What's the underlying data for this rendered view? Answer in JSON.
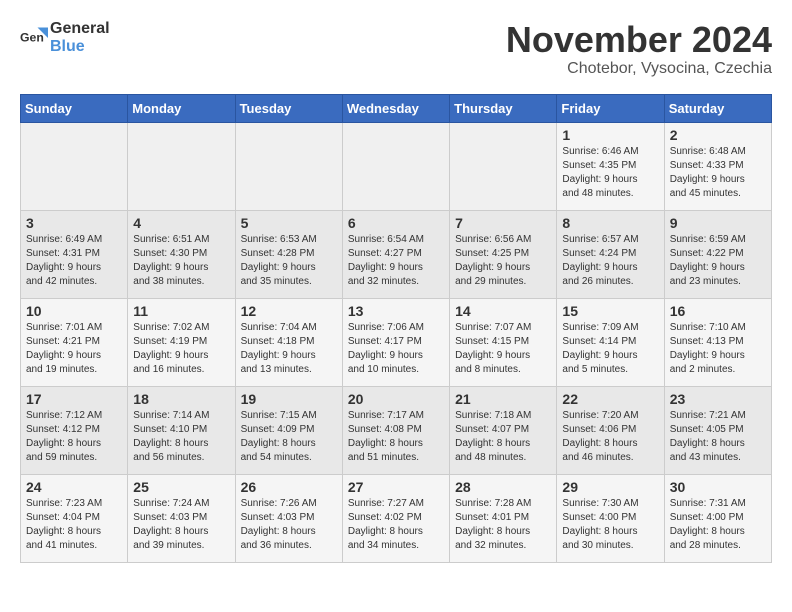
{
  "header": {
    "logo_general": "General",
    "logo_blue": "Blue",
    "month_title": "November 2024",
    "subtitle": "Chotebor, Vysocina, Czechia"
  },
  "calendar": {
    "weekdays": [
      "Sunday",
      "Monday",
      "Tuesday",
      "Wednesday",
      "Thursday",
      "Friday",
      "Saturday"
    ],
    "weeks": [
      [
        {
          "day": "",
          "info": ""
        },
        {
          "day": "",
          "info": ""
        },
        {
          "day": "",
          "info": ""
        },
        {
          "day": "",
          "info": ""
        },
        {
          "day": "",
          "info": ""
        },
        {
          "day": "1",
          "info": "Sunrise: 6:46 AM\nSunset: 4:35 PM\nDaylight: 9 hours\nand 48 minutes."
        },
        {
          "day": "2",
          "info": "Sunrise: 6:48 AM\nSunset: 4:33 PM\nDaylight: 9 hours\nand 45 minutes."
        }
      ],
      [
        {
          "day": "3",
          "info": "Sunrise: 6:49 AM\nSunset: 4:31 PM\nDaylight: 9 hours\nand 42 minutes."
        },
        {
          "day": "4",
          "info": "Sunrise: 6:51 AM\nSunset: 4:30 PM\nDaylight: 9 hours\nand 38 minutes."
        },
        {
          "day": "5",
          "info": "Sunrise: 6:53 AM\nSunset: 4:28 PM\nDaylight: 9 hours\nand 35 minutes."
        },
        {
          "day": "6",
          "info": "Sunrise: 6:54 AM\nSunset: 4:27 PM\nDaylight: 9 hours\nand 32 minutes."
        },
        {
          "day": "7",
          "info": "Sunrise: 6:56 AM\nSunset: 4:25 PM\nDaylight: 9 hours\nand 29 minutes."
        },
        {
          "day": "8",
          "info": "Sunrise: 6:57 AM\nSunset: 4:24 PM\nDaylight: 9 hours\nand 26 minutes."
        },
        {
          "day": "9",
          "info": "Sunrise: 6:59 AM\nSunset: 4:22 PM\nDaylight: 9 hours\nand 23 minutes."
        }
      ],
      [
        {
          "day": "10",
          "info": "Sunrise: 7:01 AM\nSunset: 4:21 PM\nDaylight: 9 hours\nand 19 minutes."
        },
        {
          "day": "11",
          "info": "Sunrise: 7:02 AM\nSunset: 4:19 PM\nDaylight: 9 hours\nand 16 minutes."
        },
        {
          "day": "12",
          "info": "Sunrise: 7:04 AM\nSunset: 4:18 PM\nDaylight: 9 hours\nand 13 minutes."
        },
        {
          "day": "13",
          "info": "Sunrise: 7:06 AM\nSunset: 4:17 PM\nDaylight: 9 hours\nand 10 minutes."
        },
        {
          "day": "14",
          "info": "Sunrise: 7:07 AM\nSunset: 4:15 PM\nDaylight: 9 hours\nand 8 minutes."
        },
        {
          "day": "15",
          "info": "Sunrise: 7:09 AM\nSunset: 4:14 PM\nDaylight: 9 hours\nand 5 minutes."
        },
        {
          "day": "16",
          "info": "Sunrise: 7:10 AM\nSunset: 4:13 PM\nDaylight: 9 hours\nand 2 minutes."
        }
      ],
      [
        {
          "day": "17",
          "info": "Sunrise: 7:12 AM\nSunset: 4:12 PM\nDaylight: 8 hours\nand 59 minutes."
        },
        {
          "day": "18",
          "info": "Sunrise: 7:14 AM\nSunset: 4:10 PM\nDaylight: 8 hours\nand 56 minutes."
        },
        {
          "day": "19",
          "info": "Sunrise: 7:15 AM\nSunset: 4:09 PM\nDaylight: 8 hours\nand 54 minutes."
        },
        {
          "day": "20",
          "info": "Sunrise: 7:17 AM\nSunset: 4:08 PM\nDaylight: 8 hours\nand 51 minutes."
        },
        {
          "day": "21",
          "info": "Sunrise: 7:18 AM\nSunset: 4:07 PM\nDaylight: 8 hours\nand 48 minutes."
        },
        {
          "day": "22",
          "info": "Sunrise: 7:20 AM\nSunset: 4:06 PM\nDaylight: 8 hours\nand 46 minutes."
        },
        {
          "day": "23",
          "info": "Sunrise: 7:21 AM\nSunset: 4:05 PM\nDaylight: 8 hours\nand 43 minutes."
        }
      ],
      [
        {
          "day": "24",
          "info": "Sunrise: 7:23 AM\nSunset: 4:04 PM\nDaylight: 8 hours\nand 41 minutes."
        },
        {
          "day": "25",
          "info": "Sunrise: 7:24 AM\nSunset: 4:03 PM\nDaylight: 8 hours\nand 39 minutes."
        },
        {
          "day": "26",
          "info": "Sunrise: 7:26 AM\nSunset: 4:03 PM\nDaylight: 8 hours\nand 36 minutes."
        },
        {
          "day": "27",
          "info": "Sunrise: 7:27 AM\nSunset: 4:02 PM\nDaylight: 8 hours\nand 34 minutes."
        },
        {
          "day": "28",
          "info": "Sunrise: 7:28 AM\nSunset: 4:01 PM\nDaylight: 8 hours\nand 32 minutes."
        },
        {
          "day": "29",
          "info": "Sunrise: 7:30 AM\nSunset: 4:00 PM\nDaylight: 8 hours\nand 30 minutes."
        },
        {
          "day": "30",
          "info": "Sunrise: 7:31 AM\nSunset: 4:00 PM\nDaylight: 8 hours\nand 28 minutes."
        }
      ]
    ]
  }
}
